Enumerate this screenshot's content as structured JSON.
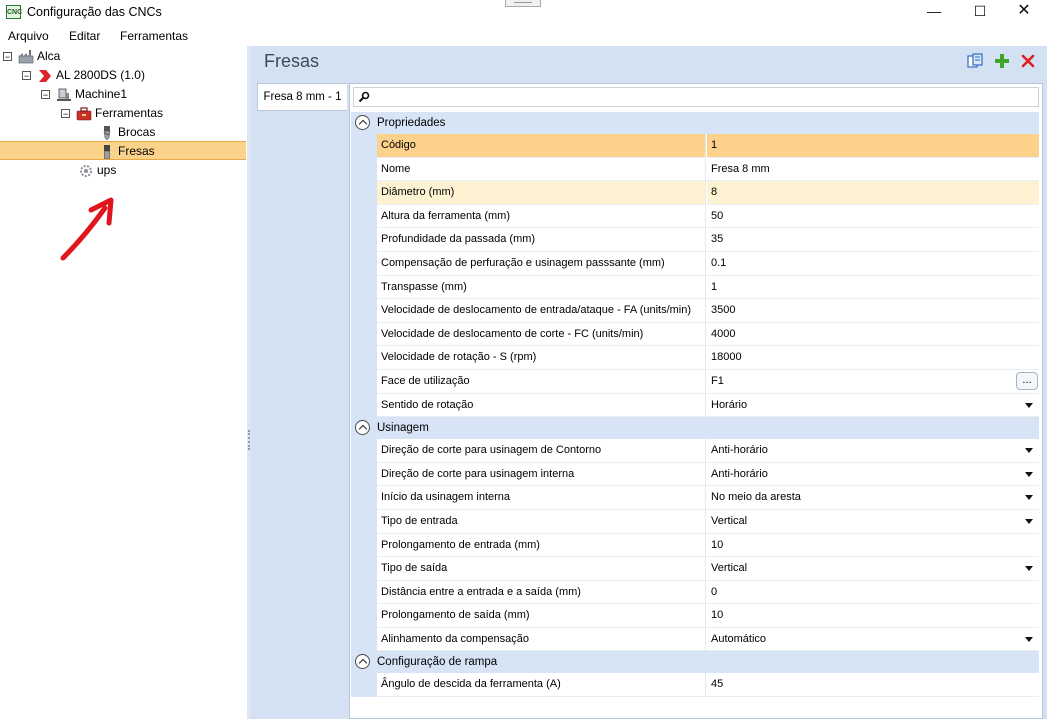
{
  "window": {
    "title": "Configuração das CNCs",
    "app_icon_text": "CNC",
    "minimize": "—",
    "maximize": "☐",
    "close": "✕"
  },
  "menu": [
    "Arquivo",
    "Editar",
    "Ferramentas"
  ],
  "tree": [
    {
      "label": "Alca",
      "expander": "−"
    },
    {
      "label": "AL 2800DS (1.0)",
      "expander": "−"
    },
    {
      "label": "Machine1",
      "expander": "−"
    },
    {
      "label": "Ferramentas",
      "expander": "−"
    },
    {
      "label": "Brocas"
    },
    {
      "label": "Fresas"
    },
    {
      "label": "ups"
    }
  ],
  "header": {
    "title": "Fresas"
  },
  "tab": {
    "label": "Fresa 8 mm - 1"
  },
  "search": {
    "value": ""
  },
  "categories": [
    {
      "label": "Propriedades",
      "rows": [
        {
          "name": "Código",
          "value": "1"
        },
        {
          "name": "Nome",
          "value": "Fresa 8 mm"
        },
        {
          "name": "Diâmetro (mm)",
          "value": "8"
        },
        {
          "name": "Altura da ferramenta (mm)",
          "value": "50"
        },
        {
          "name": "Profundidade da passada (mm)",
          "value": "35"
        },
        {
          "name": "Compensação de perfuração e usinagem passsante (mm)",
          "value": "0.1"
        },
        {
          "name": "Transpasse (mm)",
          "value": "1"
        },
        {
          "name": "Velocidade de deslocamento de entrada/ataque - FA (units/min)",
          "value": "3500"
        },
        {
          "name": "Velocidade de deslocamento de corte - FC (units/min)",
          "value": "4000"
        },
        {
          "name": "Velocidade de rotação - S (rpm)",
          "value": "18000"
        },
        {
          "name": "Face de utilização",
          "value": "F1",
          "button": "..."
        },
        {
          "name": "Sentido de rotação",
          "value": "Horário"
        }
      ]
    },
    {
      "label": "Usinagem",
      "rows": [
        {
          "name": "Direção de corte para usinagem de Contorno",
          "value": "Anti-horário"
        },
        {
          "name": "Direção de corte para usinagem interna",
          "value": "Anti-horário"
        },
        {
          "name": "Início da usinagem interna",
          "value": "No meio da aresta"
        },
        {
          "name": "Tipo de entrada",
          "value": "Vertical"
        },
        {
          "name": "Prolongamento de entrada (mm)",
          "value": "10"
        },
        {
          "name": "Tipo de saída",
          "value": "Vertical"
        },
        {
          "name": "Distância entre a entrada e a saída (mm)",
          "value": "0"
        },
        {
          "name": "Prolongamento de saída (mm)",
          "value": "10"
        },
        {
          "name": "Alinhamento da compensação",
          "value": "Automático"
        }
      ]
    },
    {
      "label": "Configuração de rampa",
      "rows": [
        {
          "name": "Ângulo de descida da ferramenta (A)",
          "value": "45"
        }
      ]
    }
  ],
  "colors": {
    "selection": "#fcd18c",
    "highlight": "#fdf3d2",
    "panel": "#d3e1f2",
    "category": "#d7e4f5"
  }
}
